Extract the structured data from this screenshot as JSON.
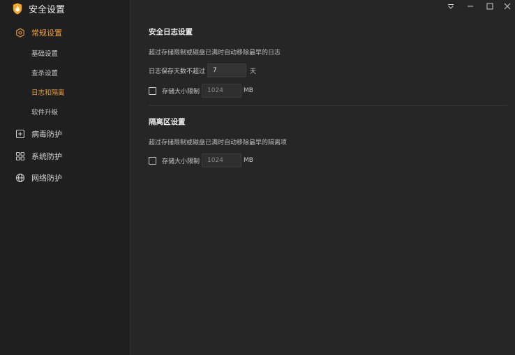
{
  "app": {
    "title": "安全设置",
    "logo_icon": "shield-flame-icon",
    "accent": "#f0a23a"
  },
  "window_controls": {
    "menu_icon": "dropdown-menu-icon",
    "minimize_icon": "minimize-icon",
    "maximize_icon": "maximize-icon",
    "close_icon": "close-icon"
  },
  "sidebar": {
    "groups": [
      {
        "label": "常规设置",
        "icon": "settings-hex-icon",
        "active": true,
        "items": [
          {
            "label": "基础设置"
          },
          {
            "label": "查杀设置"
          },
          {
            "label": "日志和隔离",
            "active": true
          },
          {
            "label": "软件升级"
          }
        ]
      },
      {
        "label": "病毒防护",
        "icon": "plus-box-icon"
      },
      {
        "label": "系统防护",
        "icon": "grid-icon"
      },
      {
        "label": "网络防护",
        "icon": "globe-icon"
      }
    ]
  },
  "log_section": {
    "title": "安全日志设置",
    "description": "超过存储限制或磁盘已满时自动移除最早的日志",
    "retention_label": "日志保存天数不超过",
    "retention_value": "7",
    "retention_unit": "天",
    "size_limit_label": "存储大小限制",
    "size_limit_value": "1024",
    "size_limit_unit": "MB"
  },
  "quarantine_section": {
    "title": "隔离区设置",
    "description": "超过存储限制或磁盘已满时自动移除最早的隔离项",
    "size_limit_label": "存储大小限制",
    "size_limit_value": "1024",
    "size_limit_unit": "MB"
  }
}
